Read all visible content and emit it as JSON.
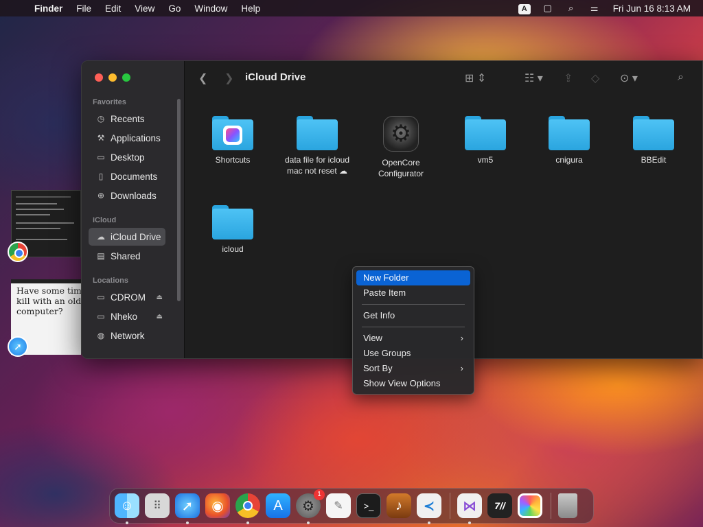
{
  "menubar": {
    "app_name": "Finder",
    "items": [
      "File",
      "Edit",
      "View",
      "Go",
      "Window",
      "Help"
    ],
    "input_indicator": "A",
    "clock": "Fri Jun 16  8:13 AM"
  },
  "finder": {
    "title": "iCloud Drive",
    "sidebar": {
      "favorites_header": "Favorites",
      "favorites": [
        "Recents",
        "Applications",
        "Desktop",
        "Documents",
        "Downloads"
      ],
      "icloud_header": "iCloud",
      "icloud": [
        "iCloud Drive",
        "Shared"
      ],
      "locations_header": "Locations",
      "locations": [
        "CDROM",
        "Nheko",
        "Network"
      ]
    },
    "files": [
      {
        "name": "Shortcuts"
      },
      {
        "name": "data file for icloud mac not reset ☁"
      },
      {
        "name": "OpenCore Configurator"
      },
      {
        "name": "vm5"
      },
      {
        "name": "cnigura"
      },
      {
        "name": "BBEdit"
      },
      {
        "name": "icloud"
      }
    ]
  },
  "context_menu": {
    "items": [
      "New Folder",
      "Paste Item",
      "Get Info",
      "View",
      "Use Groups",
      "Sort By",
      "Show View Options"
    ]
  },
  "preview": {
    "text": "Have some tim\nkill with an old\ncomputer?"
  },
  "dock": {
    "apps": [
      "Finder",
      "Launchpad",
      "Safari",
      "Firefox",
      "Chrome",
      "App Store",
      "System Settings",
      "TextEdit",
      "Terminal",
      "GarageBand",
      "VS Code",
      "Visual Studio",
      "Xcode-like",
      "Photos",
      "Trash"
    ],
    "settings_badge": "1"
  }
}
